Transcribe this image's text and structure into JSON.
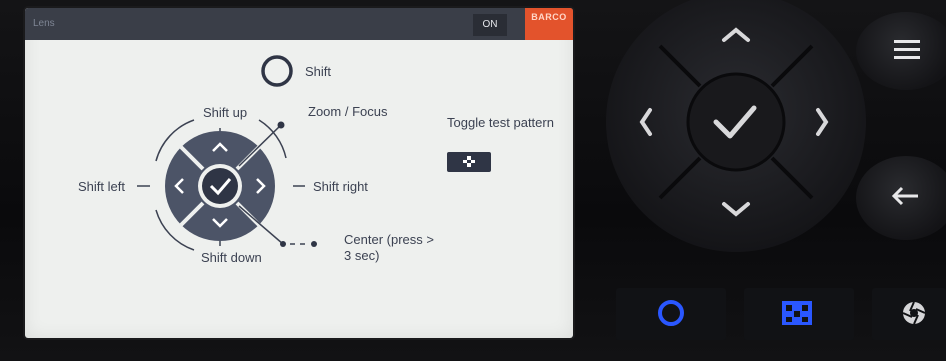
{
  "screen": {
    "title": "Lens",
    "on_label": "ON",
    "brand": "BARCO",
    "labels": {
      "shift": "Shift",
      "shift_up": "Shift up",
      "zoom_focus": "Zoom / Focus",
      "toggle_test_pattern": "Toggle test pattern",
      "shift_left": "Shift left",
      "shift_right": "Shift right",
      "center_line1": "Center (press >",
      "center_line2": "3 sec)",
      "shift_down": "Shift down"
    }
  },
  "panel": {
    "icons": [
      "up-chevron",
      "left-chevron",
      "check",
      "right-chevron",
      "down-chevron",
      "menu",
      "back-arrow",
      "ring",
      "test-pattern",
      "aperture"
    ],
    "accent_blue": "#2a57ff",
    "brand_color": "#e3532c"
  }
}
